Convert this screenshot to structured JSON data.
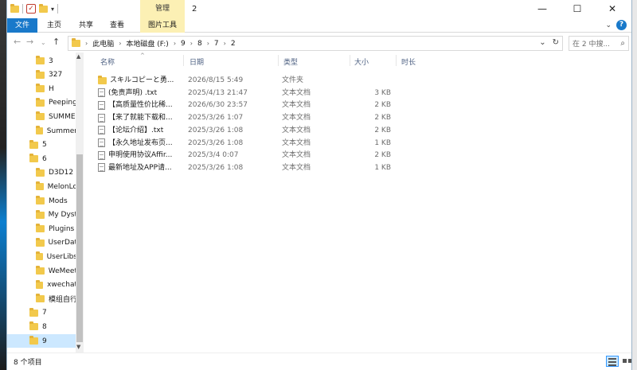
{
  "titlebar": {
    "window_title": "2",
    "context_tab": "管理",
    "minimize": "—",
    "maximize": "☐",
    "close": "✕"
  },
  "ribbon": {
    "tabs": [
      {
        "label": "文件"
      },
      {
        "label": "主页"
      },
      {
        "label": "共享"
      },
      {
        "label": "查看"
      },
      {
        "label": "图片工具"
      }
    ],
    "collapse_glyph": "⌄",
    "help_glyph": "?"
  },
  "nav_buttons": {
    "back": "←",
    "forward": "→",
    "recent": "⌄",
    "up": "↑"
  },
  "address": {
    "crumbs": [
      "此电脑",
      "本地磁盘 (F:)",
      "9",
      "8",
      "7",
      "2"
    ],
    "dropdown_glyph": "⌄",
    "refresh_glyph": "↻"
  },
  "search": {
    "placeholder": "在 2 中搜...",
    "glyph": "⌕"
  },
  "navpane": {
    "items": [
      {
        "label": "3",
        "level": 1
      },
      {
        "label": "327",
        "level": 1
      },
      {
        "label": "H",
        "level": 1
      },
      {
        "label": "Peeping",
        "level": 1
      },
      {
        "label": "SUMME",
        "level": 1
      },
      {
        "label": "Summer",
        "level": 1
      },
      {
        "label": "5",
        "level": 0
      },
      {
        "label": "6",
        "level": 0
      },
      {
        "label": "D3D12",
        "level": 1
      },
      {
        "label": "MelonLo",
        "level": 1
      },
      {
        "label": "Mods",
        "level": 1
      },
      {
        "label": "My Dyst",
        "level": 1
      },
      {
        "label": "Plugins",
        "level": 1
      },
      {
        "label": "UserDat",
        "level": 1
      },
      {
        "label": "UserLibs",
        "level": 1
      },
      {
        "label": "WeMeet",
        "level": 1
      },
      {
        "label": "xwechat",
        "level": 1
      },
      {
        "label": "模组自行",
        "level": 1
      },
      {
        "label": "7",
        "level": 0
      },
      {
        "label": "8",
        "level": 0
      },
      {
        "label": "9",
        "level": 0,
        "selected": true
      }
    ],
    "scroll_up": "▲",
    "scroll_down": "▼"
  },
  "columns": {
    "name": "名称",
    "date": "日期",
    "type": "类型",
    "size": "大小",
    "duration": "时长",
    "sort_glyph": "^"
  },
  "files": [
    {
      "icon": "folder",
      "name": "スキルコピーと勇...",
      "date": "2026/8/15 5:49",
      "type": "文件夹",
      "size": ""
    },
    {
      "icon": "doc",
      "name": "(免责声明) .txt",
      "date": "2025/4/13 21:47",
      "type": "文本文档",
      "size": "3 KB"
    },
    {
      "icon": "doc",
      "name": "【高质量性价比稀...",
      "date": "2026/6/30 23:57",
      "type": "文本文档",
      "size": "2 KB"
    },
    {
      "icon": "doc",
      "name": "【来了就能下载和...",
      "date": "2025/3/26 1:07",
      "type": "文本文档",
      "size": "2 KB"
    },
    {
      "icon": "doc",
      "name": "【论坛介绍】.txt",
      "date": "2025/3/26 1:08",
      "type": "文本文档",
      "size": "2 KB"
    },
    {
      "icon": "doc",
      "name": "【永久地址发布页...",
      "date": "2025/3/26 1:08",
      "type": "文本文档",
      "size": "1 KB"
    },
    {
      "icon": "doc",
      "name": "申明使用协议Affir...",
      "date": "2025/3/4 0:07",
      "type": "文本文档",
      "size": "2 KB"
    },
    {
      "icon": "doc",
      "name": "最新地址及APP请...",
      "date": "2025/3/26 1:08",
      "type": "文本文档",
      "size": "1 KB"
    }
  ],
  "status": {
    "count_text": "8 个项目"
  }
}
